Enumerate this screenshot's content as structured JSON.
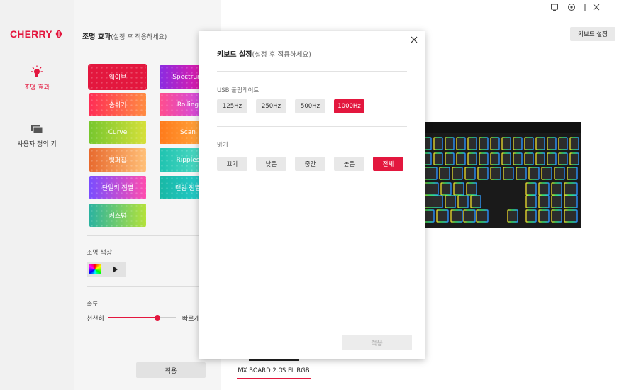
{
  "app": {
    "brand": "CHERRY"
  },
  "nav": {
    "items": [
      {
        "label": "조명 효과",
        "icon": "lightbulb-icon",
        "active": true
      },
      {
        "label": "사용자 정의 키",
        "icon": "keys-icon",
        "active": false
      }
    ]
  },
  "effects_panel": {
    "title": "조명 효과",
    "title_hint": "(설정 후 적용하세요)",
    "effects": [
      {
        "label": "웨이브",
        "gradient": "#e3173e",
        "selected": true
      },
      {
        "label": "Spectrum",
        "gradient": "linear-gradient(90deg,#8a2be2,#ff1493)"
      },
      {
        "label": "숨쉬기",
        "gradient": "linear-gradient(90deg,#ff2d55,#ff8c42)"
      },
      {
        "label": "Rolling",
        "gradient": "linear-gradient(90deg,#ff4d8d,#c04bff)"
      },
      {
        "label": "Curve",
        "gradient": "linear-gradient(90deg,#77c72e,#d6e03a)"
      },
      {
        "label": "Scan",
        "gradient": "linear-gradient(90deg,#ff7a1a,#ffb347)"
      },
      {
        "label": "빛퍼짐",
        "gradient": "linear-gradient(90deg,#e86a2e,#ffc078)"
      },
      {
        "label": "Ripples",
        "gradient": "linear-gradient(90deg,#1fc3b0,#5ee0c8)"
      },
      {
        "label": "단일키 점멸",
        "gradient": "linear-gradient(90deg,#7a4dff,#ff4dae)"
      },
      {
        "label": "랜덤 점멸",
        "gradient": "linear-gradient(90deg,#18b8a5,#29d0d5)"
      },
      {
        "label": "커스텀",
        "gradient": "linear-gradient(90deg,#2bb3a0,#b4e23a)"
      }
    ],
    "color_label": "조명 색상",
    "speed_label": "속도",
    "speed_min_label": "천천히",
    "speed_max_label": "빠르게",
    "speed_value": 0.73,
    "apply_label": "적용"
  },
  "header": {
    "keyboard_settings_label": "키보드 설정",
    "window_icons": [
      "window-icon",
      "settings-icon",
      "minimize-icon",
      "close-icon"
    ]
  },
  "device": {
    "name": "MX BOARD 2.0S FL RGB"
  },
  "modal": {
    "title": "키보드 설정",
    "title_hint": "(설정 후 적용하세요)",
    "polling": {
      "label": "USB 폴링레이트",
      "options": [
        "125Hz",
        "250Hz",
        "500Hz",
        "1000Hz"
      ],
      "selected": "1000Hz"
    },
    "brightness": {
      "label": "밝기",
      "options": [
        "끄기",
        "낮은",
        "중간",
        "높은",
        "전체"
      ],
      "selected": "전체"
    },
    "apply_label": "적용"
  },
  "colors": {
    "accent": "#e3173e",
    "nav_bg": "#f1f1f1",
    "panel_bg": "#f5f5f5"
  }
}
